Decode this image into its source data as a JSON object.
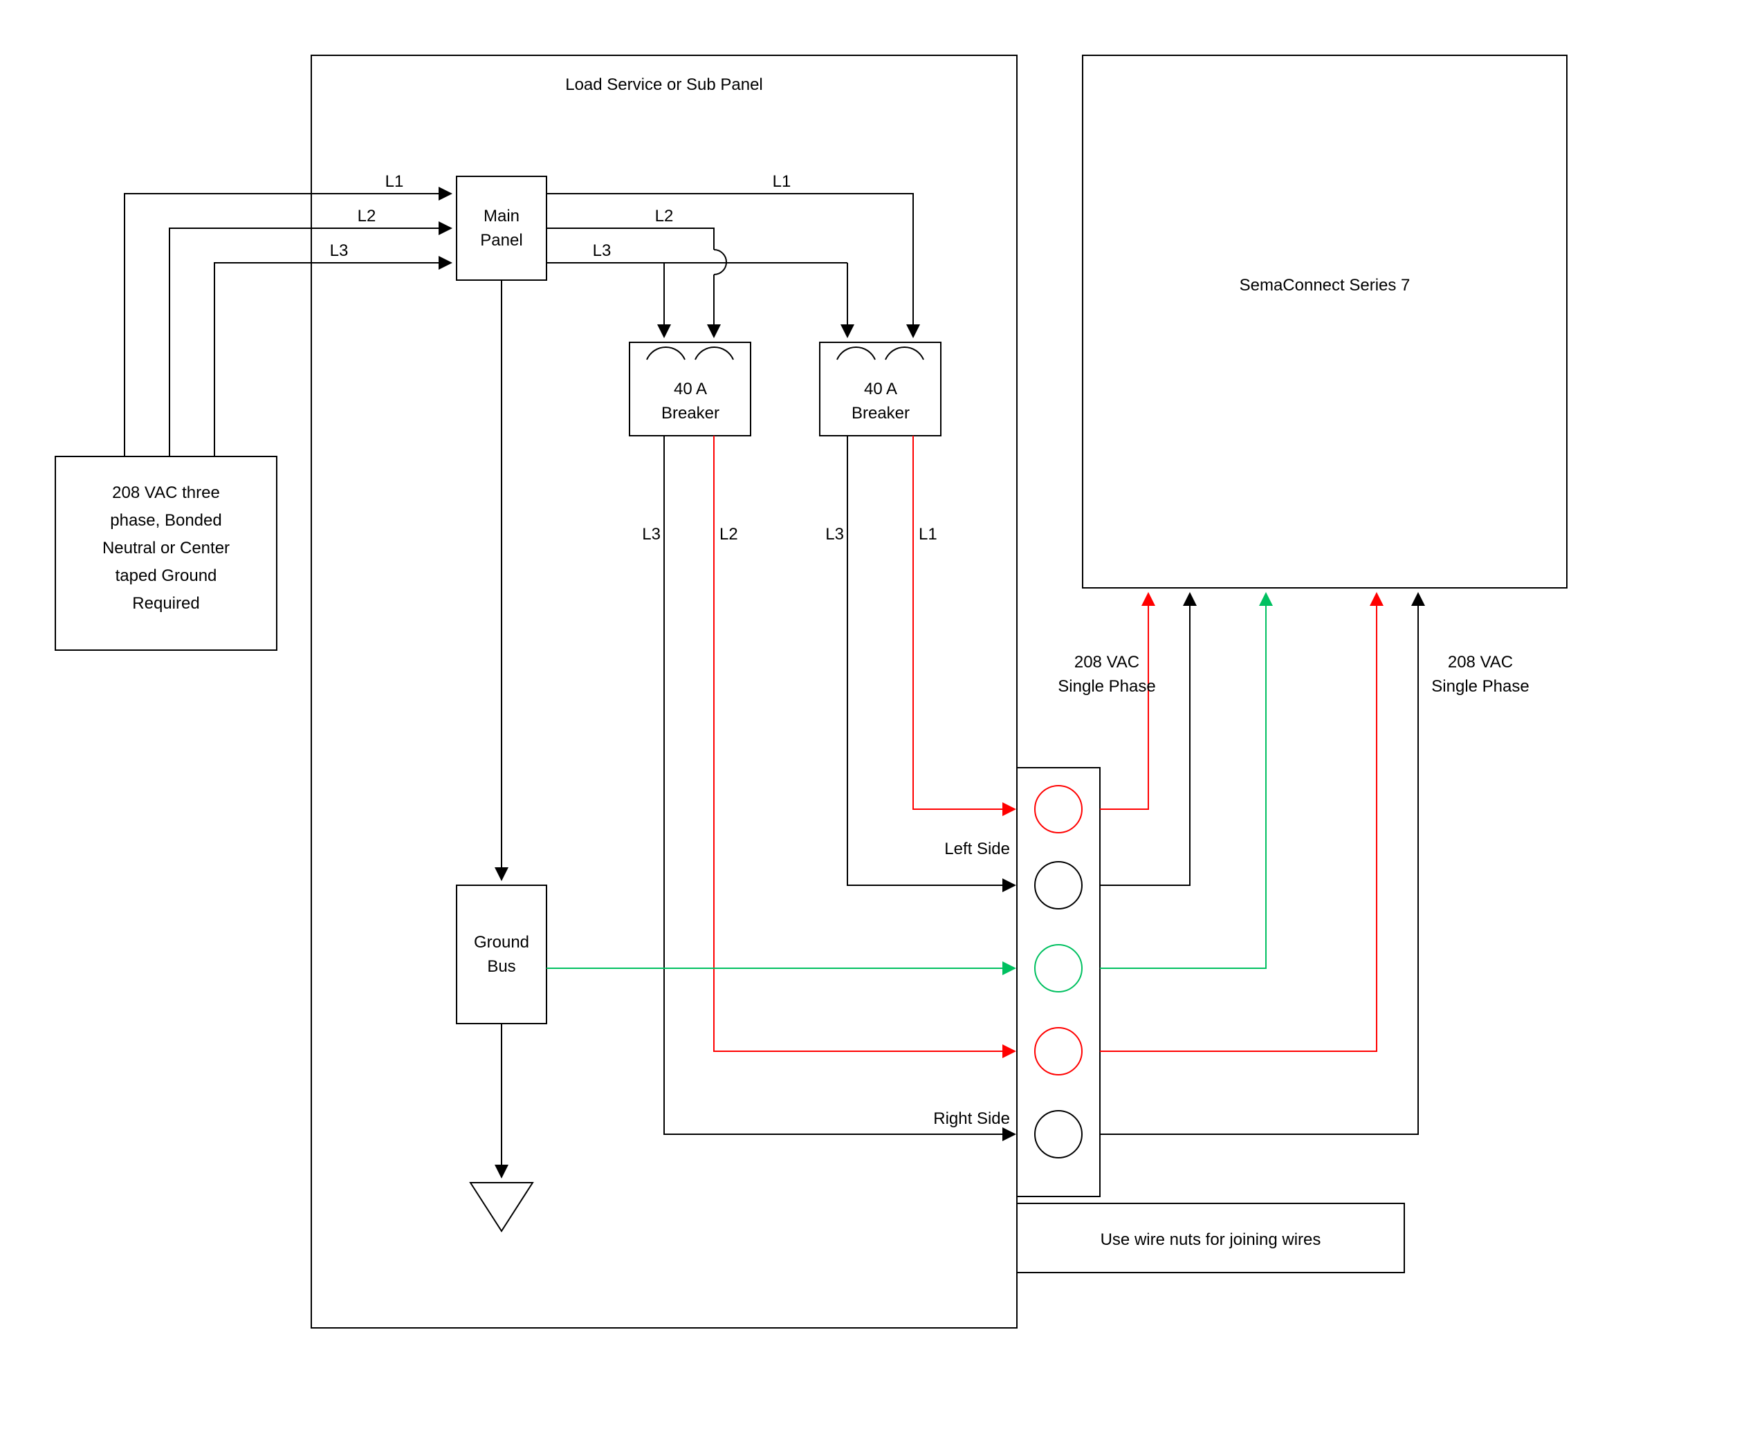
{
  "title": "Load Service or Sub Panel",
  "sourceBox": {
    "l1": "208 VAC three",
    "l2": "phase, Bonded",
    "l3": "Neutral or Center",
    "l4": "taped Ground",
    "l5": "Required"
  },
  "mainPanel": {
    "l1": "Main",
    "l2": "Panel"
  },
  "breaker1": {
    "l1": "40 A",
    "l2": "Breaker"
  },
  "breaker2": {
    "l1": "40 A",
    "l2": "Breaker"
  },
  "groundBus": {
    "l1": "Ground",
    "l2": "Bus"
  },
  "device": "SemaConnect Series 7",
  "wireNuts": "Use wire nuts for joining wires",
  "phases": {
    "L1": "L1",
    "L2": "L2",
    "L3": "L3"
  },
  "sides": {
    "left": "Left Side",
    "right": "Right Side"
  },
  "vac": {
    "l1": "208 VAC",
    "l2": "Single Phase"
  }
}
